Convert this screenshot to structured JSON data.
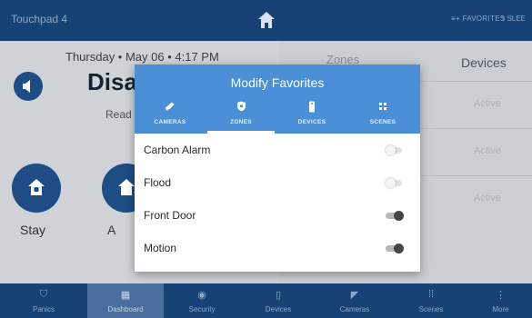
{
  "topbar": {
    "title": "Touchpad 4",
    "favorites_label": "FAVORITES",
    "sleep_label": "SLEE"
  },
  "background": {
    "date": "Thursday • May 06 • 4:17 PM",
    "status": "Disa",
    "substatus": "Read",
    "stay_label": "Stay",
    "a_label": "A",
    "zones_header": "Zones",
    "devices_header": "Devices",
    "rows": [
      "Active",
      "Active",
      "Active"
    ]
  },
  "modal": {
    "title": "Modify Favorites",
    "tabs": [
      {
        "label": "CAMERAS",
        "icon": "camera-icon"
      },
      {
        "label": "ZONES",
        "icon": "shield-icon",
        "selected": true
      },
      {
        "label": "DEVICES",
        "icon": "remote-icon"
      },
      {
        "label": "SCENES",
        "icon": "scenes-icon"
      }
    ],
    "items": [
      {
        "label": "Carbon Alarm",
        "on": false
      },
      {
        "label": "Flood",
        "on": false
      },
      {
        "label": "Front Door",
        "on": true
      },
      {
        "label": "Motion",
        "on": true
      }
    ]
  },
  "bottom_nav": [
    {
      "label": "Panics",
      "icon": "shield-icon"
    },
    {
      "label": "Dashboard",
      "icon": "dashboard-icon",
      "active": true
    },
    {
      "label": "Security",
      "icon": "lock-icon"
    },
    {
      "label": "Devices",
      "icon": "remote-icon"
    },
    {
      "label": "Cameras",
      "icon": "camera-icon"
    },
    {
      "label": "Scenes",
      "icon": "scenes-icon"
    },
    {
      "label": "More",
      "icon": "more-icon"
    }
  ],
  "colors": {
    "topbar": "#174275",
    "modal_header": "#4b8fd6",
    "accent": "#1d4d84"
  }
}
